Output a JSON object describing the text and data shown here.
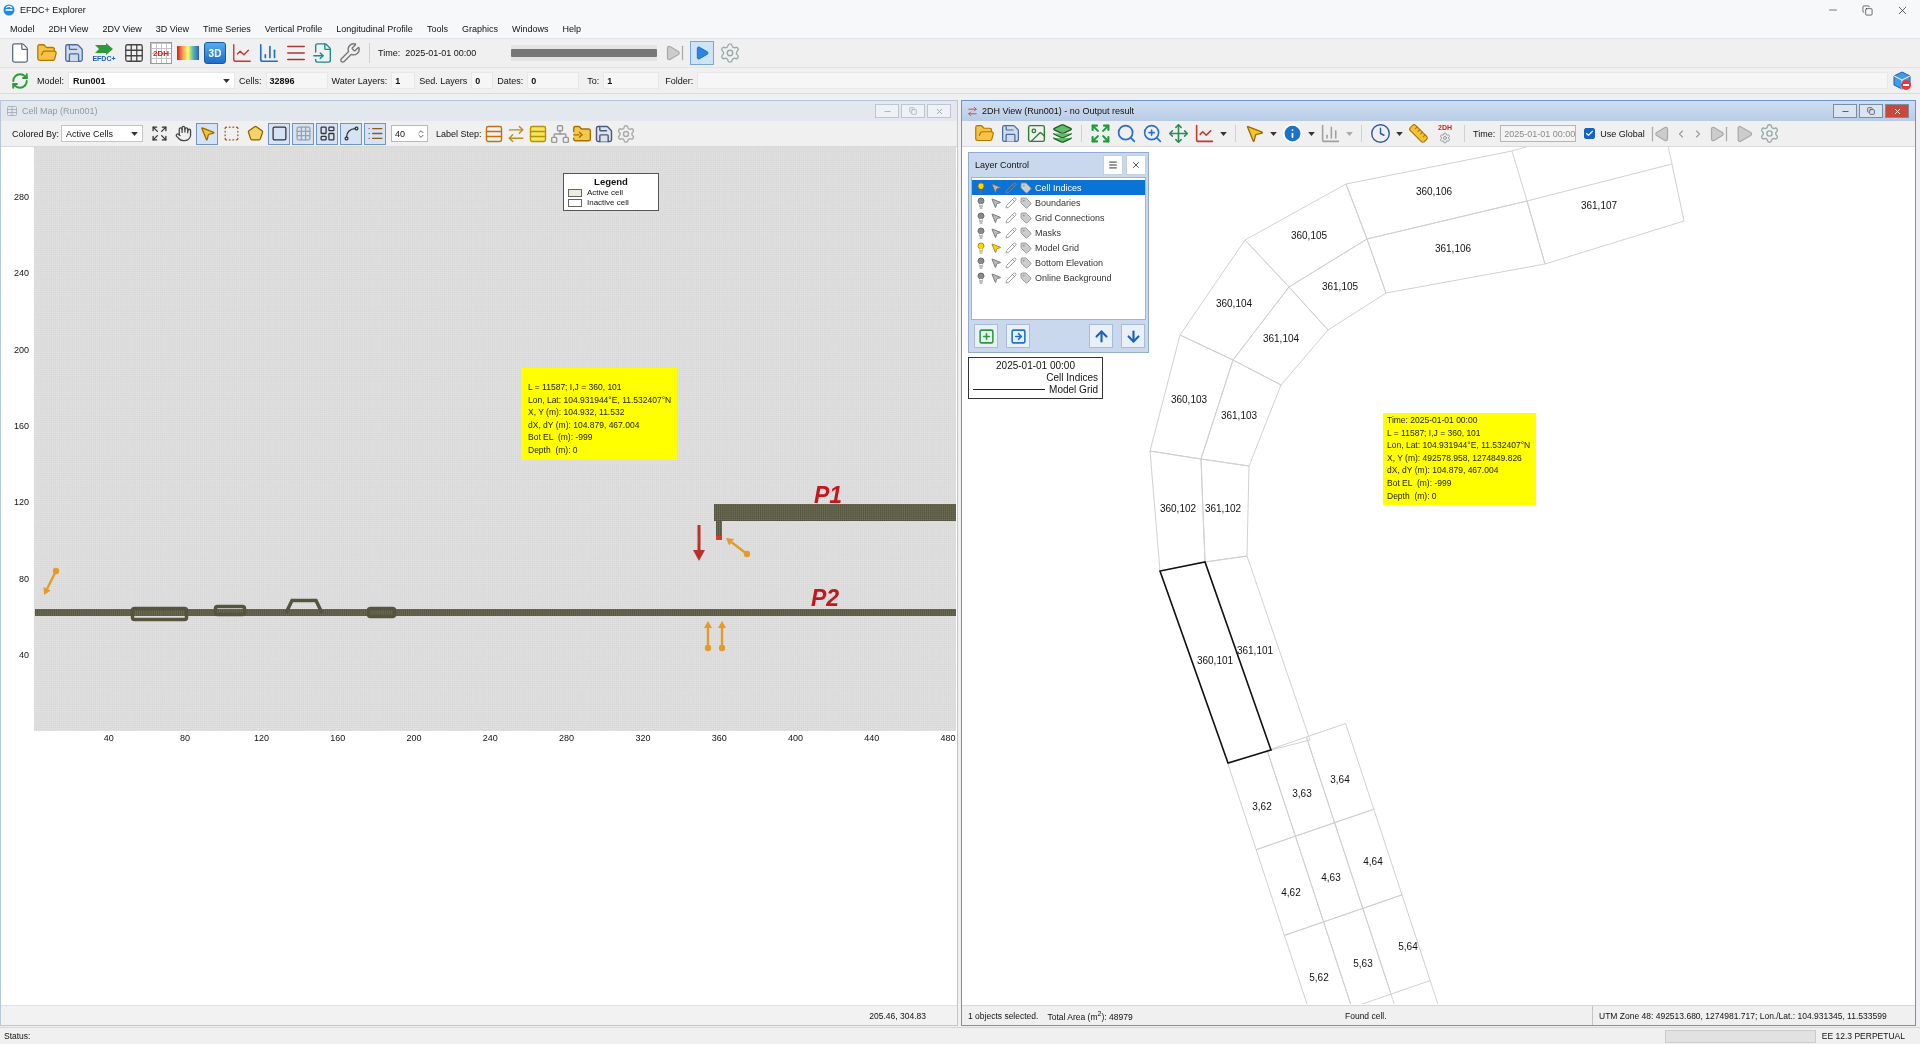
{
  "window": {
    "title": "EFDC+ Explorer"
  },
  "menu": [
    "Model",
    "2DH View",
    "2DV View",
    "3D View",
    "Time Series",
    "Vertical Profile",
    "Longitudinal Profile",
    "Tools",
    "Graphics",
    "Windows",
    "Help"
  ],
  "toolbar": {
    "efdc_button_text": "EFDC+",
    "view_2dh_button_text": "2DH",
    "view_3d_button_text": "3D",
    "time_label": "Time:",
    "time_value": "2025-01-01 00:00",
    "time_slider": {
      "level": 1
    }
  },
  "model_bar": {
    "model": {
      "label": "Model:",
      "value": "Run001"
    },
    "fields": [
      {
        "label": "Cells:",
        "value": "32896"
      },
      {
        "label": "Water Layers:",
        "value": "1"
      },
      {
        "label": "Sed. Layers",
        "value": "0"
      },
      {
        "label": "Dates:",
        "value": "0"
      },
      {
        "label": "To:",
        "value": "1"
      },
      {
        "label": "Folder:"
      }
    ]
  },
  "cell_map": {
    "title": "Cell Map (Run001)",
    "active": false,
    "colored_by": {
      "label": "Colored By:",
      "value": "Active Cells"
    },
    "tools": [
      {
        "pressed": false
      },
      {
        "pressed": false
      },
      {
        "pressed": true
      },
      {
        "pressed": false
      },
      {
        "pressed": false
      },
      {
        "pressed": true
      },
      {
        "pressed": true
      },
      {
        "pressed": true
      },
      {
        "pressed": true
      },
      {
        "pressed": true
      }
    ],
    "spin_value": "40",
    "label_step": "Label Step:",
    "y_axis": [
      "280",
      "240",
      "200",
      "160",
      "120",
      "80",
      "40"
    ],
    "x_axis": [
      "40",
      "80",
      "120",
      "160",
      "200",
      "240",
      "280",
      "320",
      "360",
      "400",
      "440",
      "480"
    ],
    "legend": {
      "title": "Legend",
      "items": [
        {
          "label": "Active cell",
          "color": "#ecebdc"
        },
        {
          "label": "Inactive cell",
          "color": "#ffffff"
        }
      ]
    },
    "tooltip": [
      "L = 11587; I,J = 360, 101",
      "Lon, Lat: 104.931944°E, 11.532407°N",
      "X, Y (m): 104.932, 11.532",
      "dX, dY (m): 104.879, 467.004",
      "Bot EL  (m): -999",
      "Depth  (m): 0"
    ],
    "markers": [
      {
        "label": "P1"
      },
      {
        "label": "P2"
      }
    ],
    "cursor": "205.46, 304.83"
  },
  "view_2dh": {
    "title": "2DH View (Run001) - no Output result",
    "active": true,
    "toolbar": {
      "badge_text": "2DH",
      "time_label": "Time:",
      "time_value": "2025-01-01 00:00",
      "use_global": {
        "label": "Use Global",
        "checked": true
      }
    },
    "layer_control": {
      "title": "Layer Control",
      "layers": [
        {
          "label": "Cell Indices",
          "selected": true,
          "visible": true,
          "selectable": false
        },
        {
          "label": "Boundaries",
          "selected": false,
          "visible": false,
          "selectable": false
        },
        {
          "label": "Grid Connections",
          "selected": false,
          "visible": false,
          "selectable": false
        },
        {
          "label": "Masks",
          "selected": false,
          "visible": false,
          "selectable": false
        },
        {
          "label": "Model Grid",
          "selected": false,
          "visible": true,
          "selectable": true
        },
        {
          "label": "Bottom Elevation",
          "selected": false,
          "visible": false,
          "selectable": false
        },
        {
          "label": "Online Background",
          "selected": false,
          "visible": false,
          "selectable": false
        }
      ]
    },
    "map_legend": {
      "time": "2025-01-01 00:00",
      "items": [
        {
          "kind": "text",
          "label": "Cell Indices"
        },
        {
          "kind": "line",
          "label": "Model Grid"
        }
      ]
    },
    "cells": [
      {
        "label": "360,106",
        "selected": false
      },
      {
        "label": "361,107",
        "selected": false
      },
      {
        "label": "360,105",
        "selected": false
      },
      {
        "label": "361,106",
        "selected": false
      },
      {
        "label": "361,105",
        "selected": false
      },
      {
        "label": "360,104",
        "selected": false
      },
      {
        "label": "361,104",
        "selected": false
      },
      {
        "label": "360,103",
        "selected": false
      },
      {
        "label": "361,103",
        "selected": false
      },
      {
        "label": "360,102",
        "selected": false
      },
      {
        "label": "361,102",
        "selected": false
      },
      {
        "label": "361,101",
        "selected": false
      },
      {
        "label": "360,101",
        "selected": true
      },
      {
        "label": "3,64",
        "selected": false
      },
      {
        "label": "3,63",
        "selected": false
      },
      {
        "label": "3,62",
        "selected": false
      },
      {
        "label": "4,64",
        "selected": false
      },
      {
        "label": "4,63",
        "selected": false
      },
      {
        "label": "4,62",
        "selected": false
      },
      {
        "label": "5,64",
        "selected": false
      },
      {
        "label": "5,63",
        "selected": false
      },
      {
        "label": "5,62",
        "selected": false
      }
    ],
    "tooltip": [
      "Time: 2025-01-01 00:00",
      "L = 11587; I,J = 360, 101",
      "Lon, Lat: 104.931944°E, 11.532407°N",
      "X, Y (m): 492578.958, 1274849.826",
      "dX, dY (m): 104.879, 467.004",
      "Bot EL  (m): -999",
      "Depth  (m): 0"
    ],
    "status": [
      "1 objects selected.",
      "Total Area (m$^{2}$): 48979",
      "Found cell.",
      "UTM Zone 48: 492513.680, 1274981.717; Lon./Lat.: 104.931345, 11.533599"
    ]
  },
  "status_bar": {
    "label": "Status:",
    "license": "EE 12.3 PERPETUAL"
  }
}
